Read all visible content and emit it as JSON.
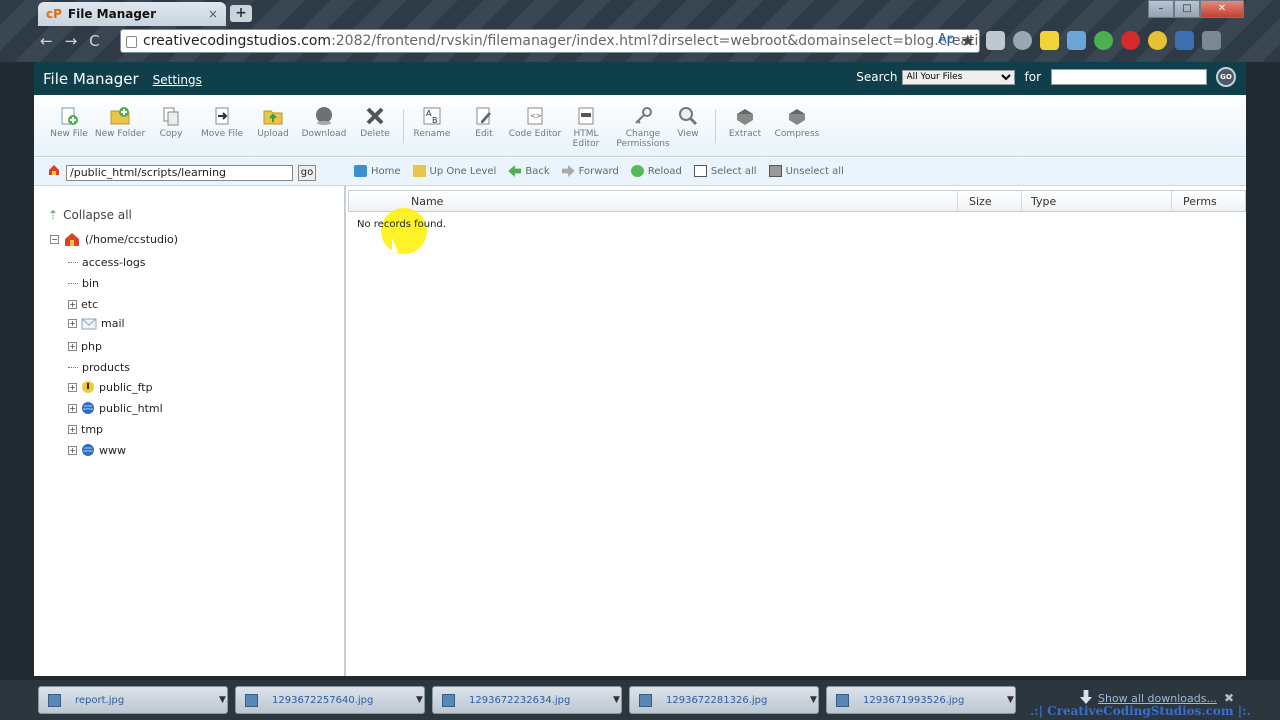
{
  "browser": {
    "tab_title": "File Manager",
    "tab_logo": "cP",
    "tab_close": "×",
    "new_tab": "+",
    "url_domain": "creativecodingstudios.com",
    "url_rest": ":2082/frontend/rvskin/filemanager/index.html?dirselect=webroot&domainselect=blog.creativecodi",
    "win_minimize": "–",
    "win_maximize": "□",
    "win_close": "✕",
    "nav_back": "←",
    "nav_forward": "→",
    "nav_reload": "C",
    "url_ap": "Ap",
    "url_star": "★"
  },
  "header": {
    "title": "File Manager",
    "settings": "Settings",
    "search_label": "Search",
    "search_scope": "All Your Files",
    "for_label": "for",
    "go": "GO"
  },
  "toolbar": [
    {
      "label": "New File"
    },
    {
      "label": "New Folder"
    },
    {
      "label": "Copy"
    },
    {
      "label": "Move File"
    },
    {
      "label": "Upload"
    },
    {
      "label": "Download"
    },
    {
      "label": "Delete"
    },
    {
      "label": "Rename"
    },
    {
      "label": "Edit"
    },
    {
      "label": "Code Editor"
    },
    {
      "label": "HTML Editor"
    },
    {
      "label": "Change Permissions"
    },
    {
      "label": "View"
    },
    {
      "label": "Extract"
    },
    {
      "label": "Compress"
    }
  ],
  "path": {
    "value": "/public_html/scripts/learning",
    "go": "go"
  },
  "navbar": {
    "home": "Home",
    "up": "Up One Level",
    "back": "Back",
    "forward": "Forward",
    "reload": "Reload",
    "select_all": "Select all",
    "unselect_all": "Unselect all"
  },
  "tree": {
    "collapse_all": "Collapse all",
    "root": "(/home/ccstudio)",
    "expander": "+",
    "root_expander": "−",
    "items": [
      {
        "label": "access-logs"
      },
      {
        "label": "bin"
      },
      {
        "label": "etc"
      },
      {
        "label": "mail"
      },
      {
        "label": "php"
      },
      {
        "label": "products"
      },
      {
        "label": "public_ftp"
      },
      {
        "label": "public_html"
      },
      {
        "label": "tmp"
      },
      {
        "label": "www"
      }
    ]
  },
  "list": {
    "columns": [
      "Name",
      "Size",
      "Type",
      "Perms"
    ],
    "empty_message": "No records found."
  },
  "downloads": {
    "items": [
      "report.jpg",
      "1293672257640.jpg",
      "1293672232634.jpg",
      "1293672281326.jpg",
      "1293671993526.jpg"
    ],
    "drop": "▼",
    "show_all": "Show all downloads...",
    "close": "✖",
    "watermark": ".:| CreativeCodingStudios.com |:."
  }
}
